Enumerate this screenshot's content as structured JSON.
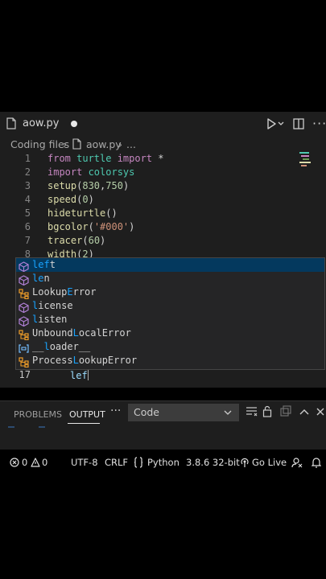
{
  "tab": {
    "title": "aow.py"
  },
  "breadcrumb": {
    "folder": "Coding files",
    "file": "aow.py",
    "more": "..."
  },
  "editor": {
    "lines": [
      {
        "num": "1",
        "tokens": [
          [
            "kw",
            "from "
          ],
          [
            "mod",
            "turtle "
          ],
          [
            "kw",
            "import "
          ],
          [
            "op",
            "*"
          ]
        ]
      },
      {
        "num": "2",
        "tokens": [
          [
            "kw",
            "import "
          ],
          [
            "mod",
            "colorsys"
          ]
        ]
      },
      {
        "num": "3",
        "tokens": [
          [
            "fn",
            "setup"
          ],
          [
            "op",
            "("
          ],
          [
            "num",
            "830"
          ],
          [
            "op",
            ","
          ],
          [
            "num",
            "750"
          ],
          [
            "op",
            ")"
          ]
        ]
      },
      {
        "num": "4",
        "tokens": [
          [
            "fn",
            "speed"
          ],
          [
            "op",
            "("
          ],
          [
            "num",
            "0"
          ],
          [
            "op",
            ")"
          ]
        ]
      },
      {
        "num": "5",
        "tokens": [
          [
            "fn",
            "hideturtle"
          ],
          [
            "op",
            "()"
          ]
        ]
      },
      {
        "num": "6",
        "tokens": [
          [
            "fn",
            "bgcolor"
          ],
          [
            "op",
            "("
          ],
          [
            "str",
            "'#000'"
          ],
          [
            "op",
            ")"
          ]
        ]
      },
      {
        "num": "7",
        "tokens": [
          [
            "fn",
            "tracer"
          ],
          [
            "op",
            "("
          ],
          [
            "num",
            "60"
          ],
          [
            "op",
            ")"
          ]
        ]
      },
      {
        "num": "8",
        "tokens": [
          [
            "fn",
            "width"
          ],
          [
            "op",
            "("
          ],
          [
            "num",
            "2"
          ],
          [
            "op",
            ")"
          ]
        ]
      }
    ],
    "current_line_num": "17",
    "current_line_text": "lef"
  },
  "suggestions": [
    {
      "icon": "keyword-icon",
      "pre": "",
      "match": "lef",
      "post": "t",
      "full": "left"
    },
    {
      "icon": "keyword-icon",
      "pre": "",
      "match": "le",
      "post": "n",
      "full": "len"
    },
    {
      "icon": "class-icon",
      "pre": "Lookup",
      "match": "E",
      "post": "rror",
      "full": "LookupError"
    },
    {
      "icon": "keyword-icon",
      "pre": "",
      "match": "l",
      "post": "icense",
      "full": "license"
    },
    {
      "icon": "keyword-icon",
      "pre": "",
      "match": "l",
      "post": "isten",
      "full": "listen"
    },
    {
      "icon": "class-icon",
      "pre": "Unbound",
      "match": "L",
      "post": "ocalError",
      "full": "UnboundLocalError"
    },
    {
      "icon": "variable-icon",
      "pre": "__",
      "match": "l",
      "post": "oader__",
      "full": "__loader__"
    },
    {
      "icon": "class-icon",
      "pre": "Process",
      "match": "L",
      "post": "ookupError",
      "full": "ProcessLookupError"
    }
  ],
  "panel": {
    "tabs": [
      "PROBLEMS",
      "OUTPUT"
    ],
    "active_tab": "OUTPUT",
    "more": "···",
    "select_value": "Code"
  },
  "status": {
    "errors": "0",
    "warnings": "0",
    "encoding": "UTF-8",
    "eol": "CRLF",
    "language": "Python",
    "interpreter": "3.8.6 32-bit",
    "live": "Go Live"
  },
  "colors": {
    "editor_bg": "#1e1e1e",
    "keyword": "#c586c0",
    "function": "#dcdcaa",
    "module": "#4ec9b0",
    "number": "#b5cea8",
    "string": "#ce9178",
    "match_highlight": "#18a3ff",
    "selection": "#04395e"
  }
}
